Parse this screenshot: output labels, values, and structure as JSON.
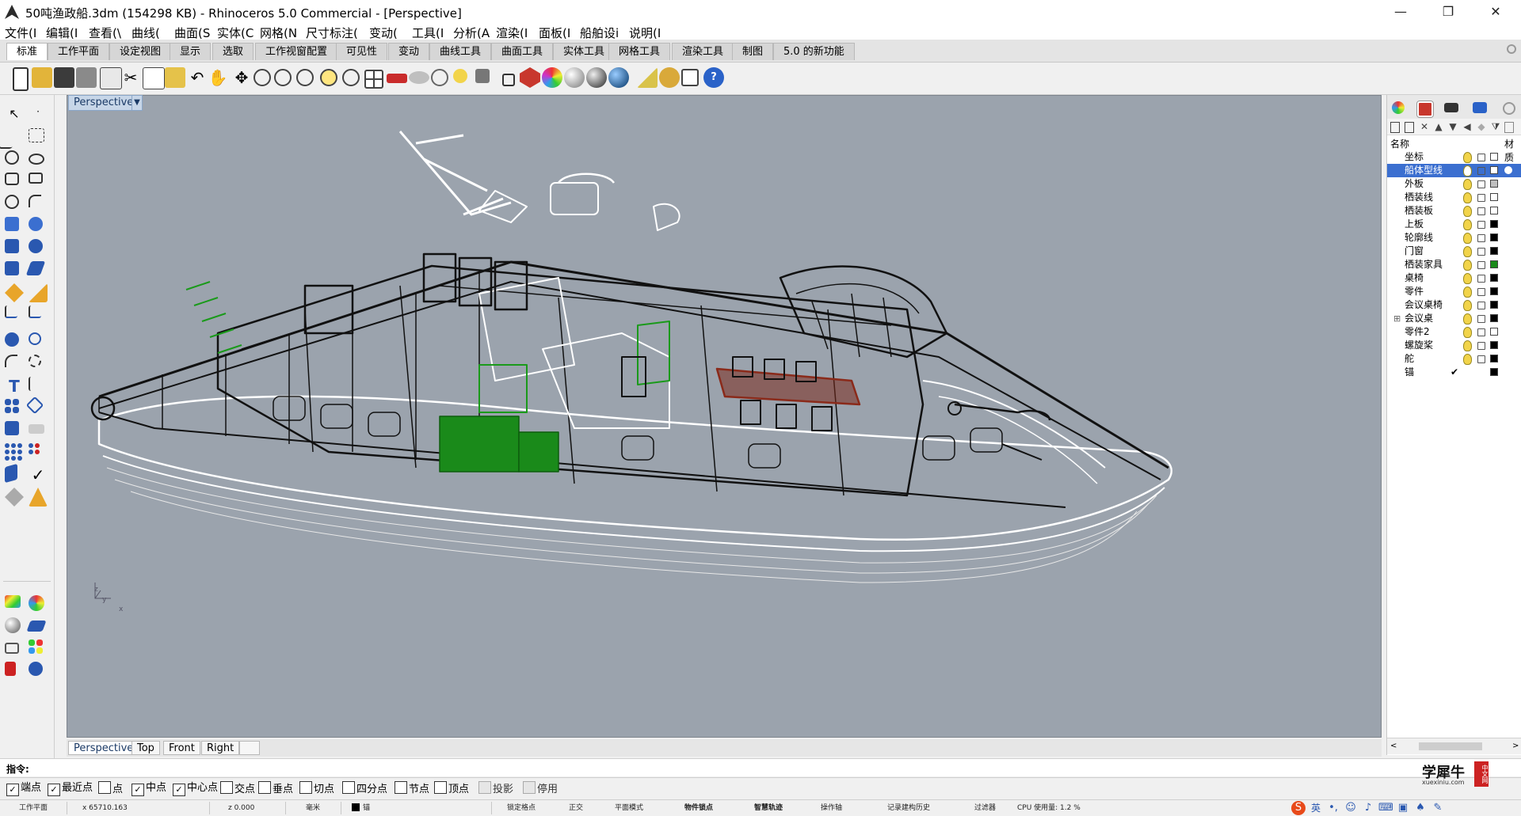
{
  "window": {
    "title": "50吨渔政船.3dm (154298 KB) - Rhinoceros 5.0 Commercial - [Perspective]",
    "minimize": "—",
    "maximize": "❐",
    "close": "✕"
  },
  "menubar": [
    "文件(I",
    "编辑(I",
    "查看(\\",
    "曲线(",
    "曲面(S",
    "实体(C",
    "网格(N",
    "尺寸标注(",
    "变动(",
    "工具(I",
    "分析(A",
    "渲染(I",
    "面板(I",
    "船舶设i",
    "说明(I"
  ],
  "tabs": [
    "标准",
    "工作平面",
    "设定视图",
    "显示",
    "选取",
    "工作视窗配置",
    "可见性",
    "变动",
    "曲线工具",
    "曲面工具",
    "实体工具",
    "网格工具",
    "渲染工具",
    "制图",
    "5.0 的新功能"
  ],
  "toolbar_icons": [
    "new-icon",
    "open-icon",
    "save-icon",
    "print-icon",
    "import-icon",
    "cut-icon",
    "copy-icon",
    "paste-icon",
    "undo-icon",
    "pan-hand-icon",
    "move-icon",
    "zoom-icon",
    "zoom-window-icon",
    "zoom-extents-icon",
    "zoom-selected-icon",
    "rotate-view-icon",
    "four-viewports-icon",
    "car-icon",
    "named-view-icon",
    "camera-icon",
    "lightbulb-icon",
    "grid-snap-icon",
    "lock-icon",
    "shade-icon",
    "render-color-icon",
    "sphere-gray-icon",
    "sphere-render-icon",
    "sphere-blue-icon",
    "options-icon",
    "gear-icon",
    "properties-icon",
    "help-icon"
  ],
  "viewport": {
    "active_label": "Perspective",
    "dropdown_arrow": "▼",
    "axis_x": "x",
    "axis_y": "y",
    "axis_z": "z"
  },
  "viewport_tabs": [
    "Perspective",
    "Top",
    "Front",
    "Right"
  ],
  "layers_panel": {
    "header_name": "名称",
    "header_material": "材质",
    "layers": [
      {
        "name": "坐标",
        "color": "#ffffff",
        "selected": false
      },
      {
        "name": "船体型线",
        "color": "#ffffff",
        "selected": true
      },
      {
        "name": "外板",
        "color": "#c0c0c0",
        "selected": false
      },
      {
        "name": "栖装线",
        "color": "#ffffff",
        "selected": false
      },
      {
        "name": "栖装板",
        "color": "#ffffff",
        "selected": false
      },
      {
        "name": "上板",
        "color": "#000000",
        "selected": false
      },
      {
        "name": "轮廓线",
        "color": "#000000",
        "selected": false
      },
      {
        "name": "门窗",
        "color": "#000000",
        "selected": false
      },
      {
        "name": "栖装家具",
        "color": "#1a8a1a",
        "selected": false
      },
      {
        "name": "桌椅",
        "color": "#000000",
        "selected": false
      },
      {
        "name": "零件",
        "color": "#000000",
        "selected": false
      },
      {
        "name": "会议桌椅",
        "color": "#000000",
        "selected": false
      },
      {
        "name": "会议桌",
        "color": "#000000",
        "selected": false,
        "expandable": true
      },
      {
        "name": "零件2",
        "color": "#ffffff",
        "selected": false
      },
      {
        "name": "螺旋桨",
        "color": "#000000",
        "selected": false
      },
      {
        "name": "舵",
        "color": "#000000",
        "selected": false
      },
      {
        "name": "锚",
        "color": "#000000",
        "selected": false,
        "current": true
      }
    ],
    "current_mark": "✔"
  },
  "command": {
    "label": "指令:",
    "value": ""
  },
  "osnaps": [
    {
      "label": "端点",
      "checked": true
    },
    {
      "label": "最近点",
      "checked": true
    },
    {
      "label": "点",
      "checked": false
    },
    {
      "label": "中点",
      "checked": true
    },
    {
      "label": "中心点",
      "checked": true
    },
    {
      "label": "交点",
      "checked": false
    },
    {
      "label": "垂点",
      "checked": false
    },
    {
      "label": "切点",
      "checked": false
    },
    {
      "label": "四分点",
      "checked": false
    },
    {
      "label": "节点",
      "checked": false
    },
    {
      "label": "顶点",
      "checked": false
    },
    {
      "label": "投影",
      "checked": false,
      "disabled": true
    },
    {
      "label": "停用",
      "checked": false,
      "disabled": true
    }
  ],
  "statusbar": {
    "cplane": "工作平面",
    "x": "x 65710.163",
    "z": "z 0.000",
    "units": "毫米",
    "layer": "锚",
    "grid_snap": "锁定格点",
    "ortho": "正交",
    "planar": "平面模式",
    "osnap": "物件锁点",
    "smarttrack": "智慧轨迹",
    "gumball": "操作轴",
    "history": "记录建构历史",
    "filter": "过滤器",
    "cpu": "CPU 使用量: 1.2 %"
  },
  "tray": {
    "ime": "英",
    "watermark": "学犀牛",
    "watermark_url": "xuexiniu.com",
    "watermark_badge": "中文网"
  },
  "colors": {
    "viewport_bg": "#9ba3ad",
    "selection": "#3b6fd0",
    "green_layer": "#1a8a1a",
    "red_layer": "#8a2a1a"
  }
}
